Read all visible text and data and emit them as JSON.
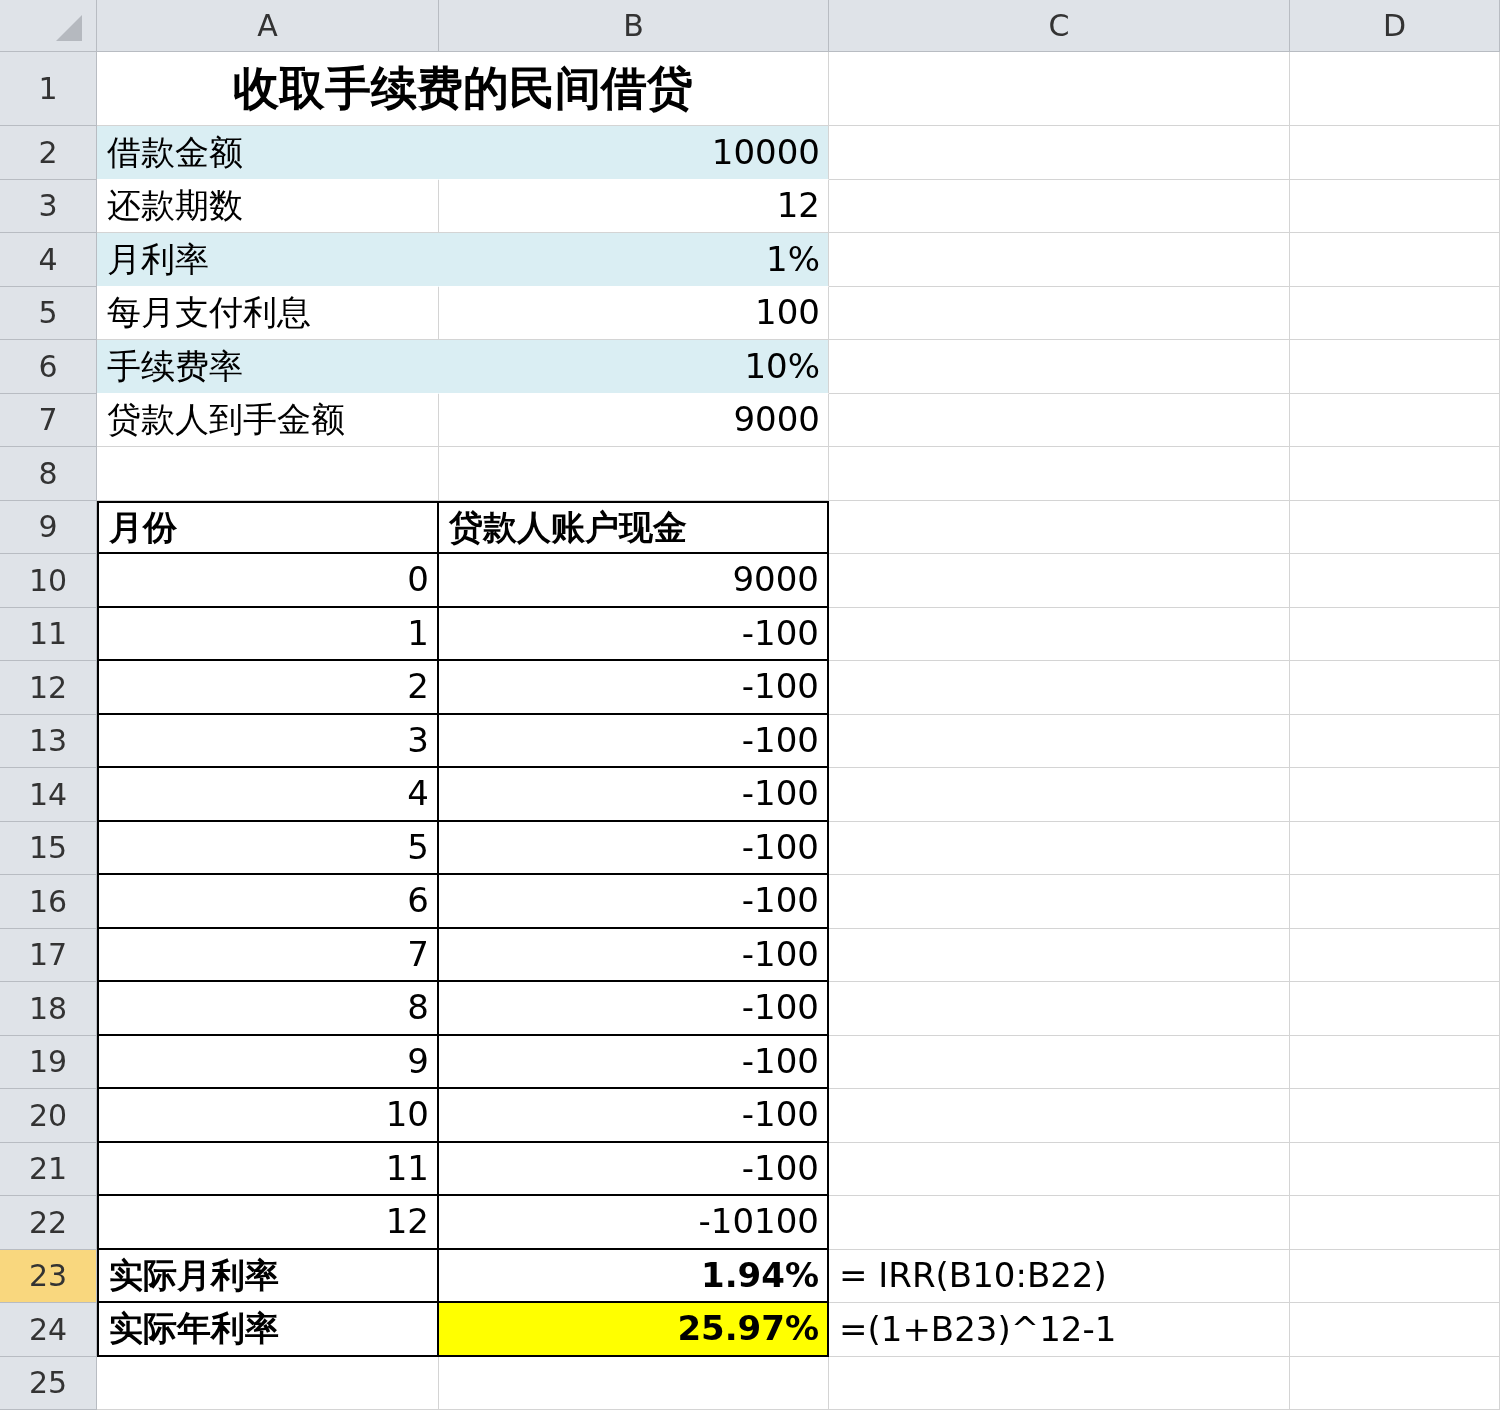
{
  "columns": [
    {
      "label": "A",
      "selected": false
    },
    {
      "label": "B",
      "selected": false
    },
    {
      "label": "C",
      "selected": false
    },
    {
      "label": "D",
      "selected": false
    }
  ],
  "rows": [
    {
      "header": "1",
      "selected": false,
      "shaded": false,
      "boxed": false,
      "title": "收取手续费的民间借贷"
    },
    {
      "header": "2",
      "selected": false,
      "shaded": true,
      "boxed": false,
      "a": {
        "text": "借款金额",
        "kind": "label"
      },
      "b": {
        "text": "10000",
        "kind": "number"
      }
    },
    {
      "header": "3",
      "selected": false,
      "shaded": false,
      "boxed": false,
      "a": {
        "text": "还款期数",
        "kind": "label"
      },
      "b": {
        "text": "12",
        "kind": "number"
      }
    },
    {
      "header": "4",
      "selected": false,
      "shaded": true,
      "boxed": false,
      "a": {
        "text": "月利率",
        "kind": "label"
      },
      "b": {
        "text": "1%",
        "kind": "number"
      }
    },
    {
      "header": "5",
      "selected": false,
      "shaded": false,
      "boxed": false,
      "a": {
        "text": "每月支付利息",
        "kind": "label"
      },
      "b": {
        "text": "100",
        "kind": "number"
      }
    },
    {
      "header": "6",
      "selected": false,
      "shaded": true,
      "boxed": false,
      "a": {
        "text": "手续费率",
        "kind": "label"
      },
      "b": {
        "text": "10%",
        "kind": "number"
      }
    },
    {
      "header": "7",
      "selected": false,
      "shaded": false,
      "boxed": false,
      "a": {
        "text": "贷款人到手金额",
        "kind": "label"
      },
      "b": {
        "text": "9000",
        "kind": "number"
      }
    },
    {
      "header": "8",
      "selected": false,
      "shaded": false,
      "boxed": false
    },
    {
      "header": "9",
      "selected": false,
      "shaded": false,
      "boxed": true,
      "a": {
        "text": "月份",
        "kind": "head"
      },
      "b": {
        "text": "贷款人账户现金",
        "kind": "head"
      }
    },
    {
      "header": "10",
      "selected": false,
      "shaded": false,
      "boxed": true,
      "a": {
        "text": "0",
        "kind": "number"
      },
      "b": {
        "text": "9000",
        "kind": "number"
      }
    },
    {
      "header": "11",
      "selected": false,
      "shaded": false,
      "boxed": true,
      "a": {
        "text": "1",
        "kind": "number"
      },
      "b": {
        "text": "-100",
        "kind": "number"
      }
    },
    {
      "header": "12",
      "selected": false,
      "shaded": false,
      "boxed": true,
      "a": {
        "text": "2",
        "kind": "number"
      },
      "b": {
        "text": "-100",
        "kind": "number"
      }
    },
    {
      "header": "13",
      "selected": false,
      "shaded": false,
      "boxed": true,
      "a": {
        "text": "3",
        "kind": "number"
      },
      "b": {
        "text": "-100",
        "kind": "number"
      }
    },
    {
      "header": "14",
      "selected": false,
      "shaded": false,
      "boxed": true,
      "a": {
        "text": "4",
        "kind": "number"
      },
      "b": {
        "text": "-100",
        "kind": "number"
      }
    },
    {
      "header": "15",
      "selected": false,
      "shaded": false,
      "boxed": true,
      "a": {
        "text": "5",
        "kind": "number"
      },
      "b": {
        "text": "-100",
        "kind": "number"
      }
    },
    {
      "header": "16",
      "selected": false,
      "shaded": false,
      "boxed": true,
      "a": {
        "text": "6",
        "kind": "number"
      },
      "b": {
        "text": "-100",
        "kind": "number"
      }
    },
    {
      "header": "17",
      "selected": false,
      "shaded": false,
      "boxed": true,
      "a": {
        "text": "7",
        "kind": "number"
      },
      "b": {
        "text": "-100",
        "kind": "number"
      }
    },
    {
      "header": "18",
      "selected": false,
      "shaded": false,
      "boxed": true,
      "a": {
        "text": "8",
        "kind": "number"
      },
      "b": {
        "text": "-100",
        "kind": "number"
      }
    },
    {
      "header": "19",
      "selected": false,
      "shaded": false,
      "boxed": true,
      "a": {
        "text": "9",
        "kind": "number"
      },
      "b": {
        "text": "-100",
        "kind": "number"
      }
    },
    {
      "header": "20",
      "selected": false,
      "shaded": false,
      "boxed": true,
      "a": {
        "text": "10",
        "kind": "number"
      },
      "b": {
        "text": "-100",
        "kind": "number"
      }
    },
    {
      "header": "21",
      "selected": false,
      "shaded": false,
      "boxed": true,
      "a": {
        "text": "11",
        "kind": "number"
      },
      "b": {
        "text": "-100",
        "kind": "number"
      }
    },
    {
      "header": "22",
      "selected": false,
      "shaded": false,
      "boxed": true,
      "a": {
        "text": "12",
        "kind": "number"
      },
      "b": {
        "text": "-10100",
        "kind": "number"
      }
    },
    {
      "header": "23",
      "selected": true,
      "shaded": false,
      "boxed": true,
      "a": {
        "text": "实际月利率",
        "kind": "head"
      },
      "b": {
        "text": "1.94%",
        "kind": "bold-number",
        "highlight": false
      },
      "c": {
        "text": "= IRR(B10:B22)",
        "kind": "label"
      }
    },
    {
      "header": "24",
      "selected": false,
      "shaded": false,
      "boxed": true,
      "a": {
        "text": "实际年利率",
        "kind": "head"
      },
      "b": {
        "text": "25.97%",
        "kind": "bold-number",
        "highlight": true
      },
      "c": {
        "text": "=(1+B23)^12-1",
        "kind": "label"
      }
    },
    {
      "header": "25",
      "selected": false,
      "shaded": false,
      "boxed": false
    }
  ]
}
